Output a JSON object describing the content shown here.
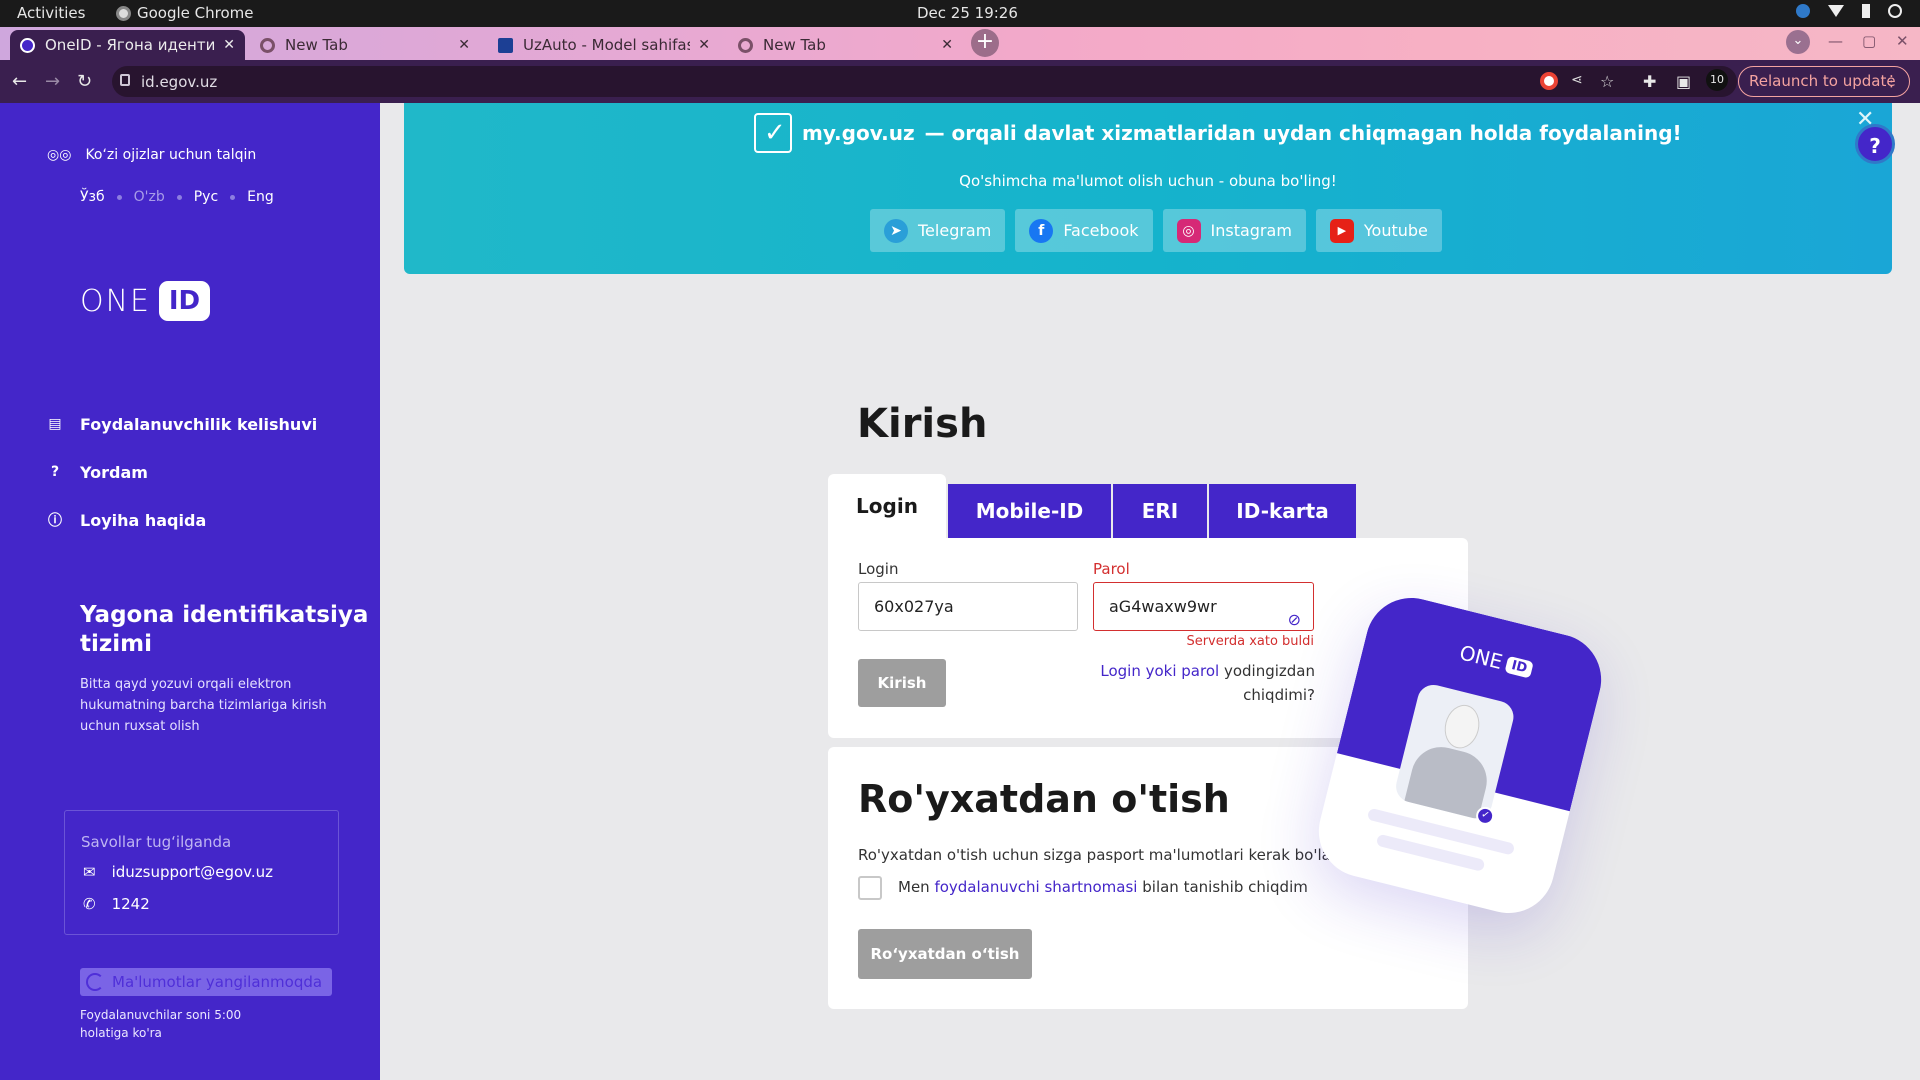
{
  "os": {
    "activities": "Activities",
    "app_name": "Google Chrome",
    "clock": "Dec 25  19:26"
  },
  "tabs": [
    {
      "title": "OneID - Ягона идентиф",
      "active": true
    },
    {
      "title": "New Tab",
      "active": false
    },
    {
      "title": "UzAuto - Model sahifasi",
      "active": false
    },
    {
      "title": "New Tab",
      "active": false
    }
  ],
  "address": {
    "url": "id.egov.uz",
    "relaunch": "Relaunch to update"
  },
  "sidebar": {
    "accessibility": "Ko‘zi ojizlar uchun talqin",
    "languages": [
      "Ўзб",
      "O'zb",
      "Рус",
      "Eng"
    ],
    "logo_text": "ONE",
    "logo_badge": "ID",
    "menu": [
      {
        "label": "Foydalanuvchilik kelishuvi",
        "icon": "document-icon"
      },
      {
        "label": "Yordam",
        "icon": "question-icon"
      },
      {
        "label": "Loyiha haqida",
        "icon": "info-icon"
      }
    ],
    "headline": "Yagona identifikatsiya tizimi",
    "description": "Bitta qayd yozuvi orqali elektron hukumatning barcha tizimlariga kirish uchun ruxsat olish",
    "support": {
      "title": "Savollar tug‘ilganda",
      "email": "iduzsupport@egov.uz",
      "phone": "1242"
    },
    "updating": "Ma'lumotlar yangilanmoqda",
    "users_note": "Foydalanuvchilar soni 5:00 holatiga ko'ra"
  },
  "banner": {
    "brand": "my.gov.uz",
    "headline": " — orqali davlat xizmatlaridan uydan chiqmagan holda foydalaning!",
    "subtitle": "Qo'shimcha ma'lumot olish uchun - obuna bo'ling!",
    "social": [
      {
        "label": "Telegram",
        "icon": "telegram-icon",
        "color": "#2a9fd8"
      },
      {
        "label": "Facebook",
        "icon": "facebook-icon",
        "color": "#1877f2"
      },
      {
        "label": "Instagram",
        "icon": "instagram-icon",
        "color": "#d62976"
      },
      {
        "label": "Youtube",
        "icon": "youtube-icon",
        "color": "#e62117"
      }
    ]
  },
  "login": {
    "title": "Kirish",
    "tabs": [
      "Login",
      "Mobile-ID",
      "ERI",
      "ID-karta"
    ],
    "login_label": "Login",
    "login_value": "60x027ya",
    "password_label": "Parol",
    "password_value": "aG4waxw9wr",
    "error": "Serverda xato buldi",
    "submit": "Kirish",
    "forgot_link": "Login yoki parol",
    "forgot_rest": " yodingizdan chiqdimi?"
  },
  "register": {
    "title": "Ro'yxatdan o'tish",
    "note": "Ro'yxatdan o'tish uchun sizga pasport ma'lumotlari kerak bo'ladi.",
    "agree_prefix": "Men ",
    "agree_link": "foydalanuvchi shartnomasi",
    "agree_suffix": " bilan tanishib chiqdim",
    "button": "Ro‘yxatdan o‘tish"
  },
  "illustration": {
    "brand": "ONE",
    "badge": "ID"
  },
  "colors": {
    "primary": "#4426c9",
    "error": "#d32f2f",
    "banner": "#15b3cc"
  }
}
